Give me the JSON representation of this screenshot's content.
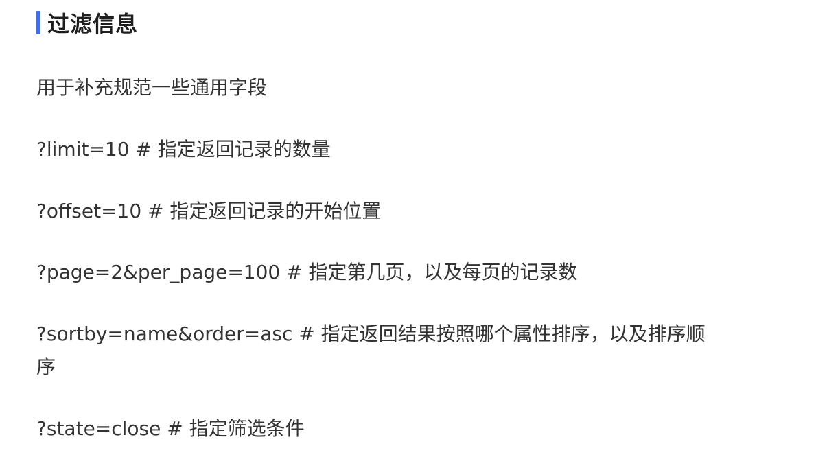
{
  "heading": {
    "text": "过滤信息",
    "accent_color": "#3f6ff0"
  },
  "intro": "用于补充规范一些通用字段",
  "params": [
    {
      "text": "?limit=10 # 指定返回记录的数量"
    },
    {
      "text": "?offset=10 # 指定返回记录的开始位置"
    },
    {
      "text": "?page=2&per_page=100 # 指定第几页，以及每页的记录数"
    },
    {
      "text": "?sortby=name&order=asc # 指定返回结果按照哪个属性排序，以及排序顺",
      "continuation": "序"
    },
    {
      "text": "?state=close # 指定筛选条件"
    }
  ]
}
